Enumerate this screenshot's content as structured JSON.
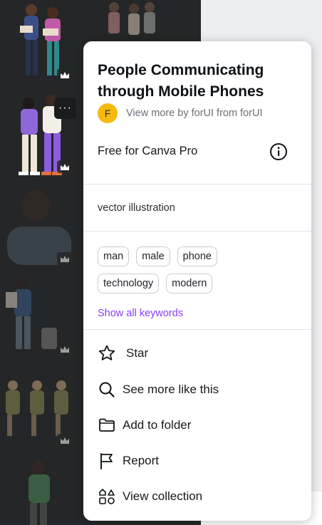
{
  "asset": {
    "title": "People Communicating through Mobile Phones",
    "author_initial": "F",
    "author_link": "View more by forUI from forUI",
    "license": "Free for Canva Pro",
    "description": "vector illustration"
  },
  "keywords": {
    "row1": [
      "man",
      "male",
      "phone"
    ],
    "row2": [
      "technology",
      "modern"
    ],
    "show_all": "Show all keywords"
  },
  "menu": {
    "star": "Star",
    "see_more": "See more like this",
    "add_folder": "Add to folder",
    "report": "Report",
    "view_collection": "View collection"
  },
  "thumbnails": {
    "more_button": "···"
  },
  "colors": {
    "accent": "#8b3dff",
    "avatar": "#f5b90f",
    "backdrop": "#252627"
  },
  "icons": {
    "info": "info-icon",
    "star": "star-icon",
    "search": "search-icon",
    "folder": "folder-icon",
    "flag": "flag-icon",
    "shapes": "shapes-icon",
    "crown": "crown-icon"
  }
}
